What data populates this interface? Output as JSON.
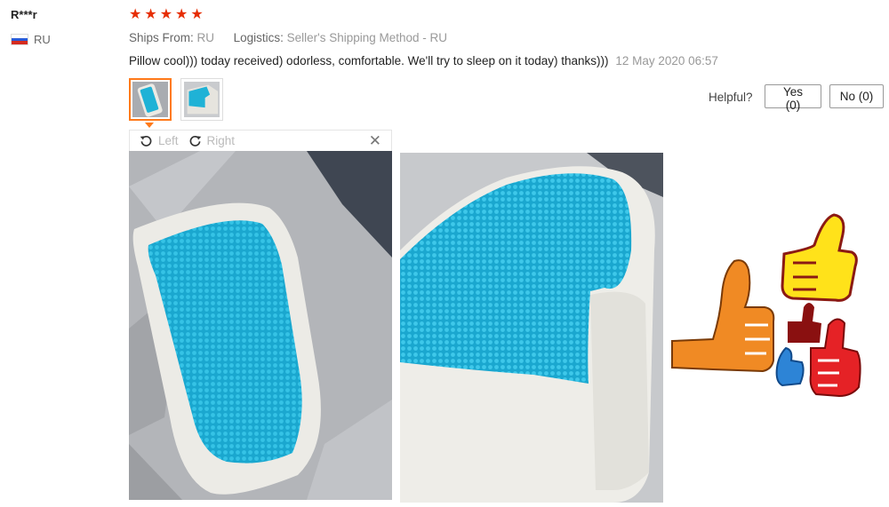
{
  "reviewer": {
    "name": "R***r",
    "country": "RU",
    "rating": 5
  },
  "shipping": {
    "ships_from_label": "Ships From:",
    "ships_from_value": "RU",
    "logistics_label": "Logistics:",
    "logistics_value": "Seller's Shipping Method - RU"
  },
  "review": {
    "text": "Pillow cool))) today received) odorless, comfortable. We'll try to sleep on it today) thanks)))",
    "date": "12 May 2020 06:57"
  },
  "helpful": {
    "label": "Helpful?",
    "yes": "Yes (0)",
    "no": "No (0)"
  },
  "viewer": {
    "rotate_left": "Left",
    "rotate_right": "Right",
    "close_icon": "close-icon"
  },
  "colors": {
    "star": "#e62e04",
    "thumb_active": "#ff7a1a",
    "gel_blue": "#1fb2d6"
  }
}
